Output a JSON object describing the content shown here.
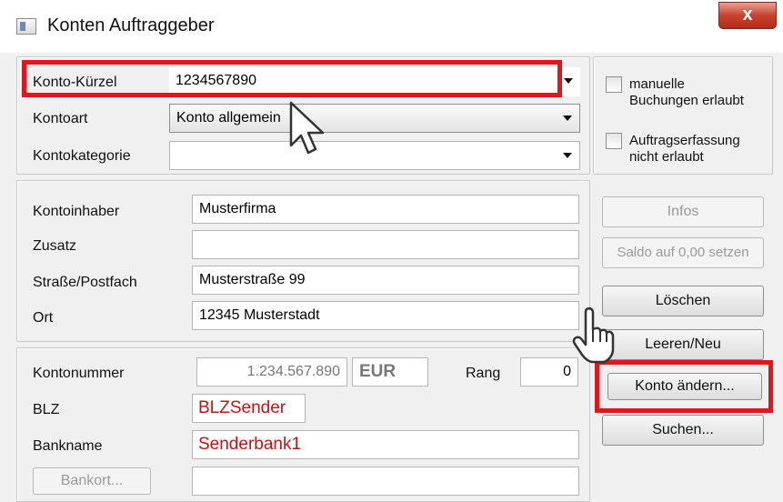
{
  "window": {
    "title": "Konten Auftraggeber",
    "close_symbol": "x"
  },
  "account": {
    "konto_kuerzel_label": "Konto-Kürzel",
    "konto_kuerzel_value": "1234567890",
    "kontoart_label": "Kontoart",
    "kontoart_value": "Konto allgemein",
    "kontokategorie_label": "Kontokategorie",
    "kontokategorie_value": ""
  },
  "options": {
    "manuelle_buchungen_line1": "manuelle",
    "manuelle_buchungen_line2": "Buchungen erlaubt",
    "auftragserfassung_line1": "Auftragserfassung",
    "auftragserfassung_line2": "nicht erlaubt"
  },
  "holder": {
    "kontoinhaber_label": "Kontoinhaber",
    "kontoinhaber_value": "Musterfirma",
    "zusatz_label": "Zusatz",
    "zusatz_value": "",
    "strasse_label": "Straße/Postfach",
    "strasse_value": "Musterstraße 99",
    "ort_label": "Ort",
    "ort_value": "12345 Musterstadt"
  },
  "bank": {
    "kontonummer_label": "Kontonummer",
    "kontonummer_value": "1.234.567.890",
    "currency": "EUR",
    "rang_label": "Rang",
    "rang_value": "0",
    "blz_label": "BLZ",
    "blz_value": "BLZSender",
    "bankname_label": "Bankname",
    "bankname_value": "Senderbank1",
    "bankort_button": "Bankort...",
    "bankort_value": ""
  },
  "buttons": {
    "infos": "Infos",
    "saldo": "Saldo auf 0,00 setzen",
    "loeschen": "Löschen",
    "leeren_neu": "Leeren/Neu",
    "konto_aendern": "Konto ändern...",
    "suchen": "Suchen..."
  },
  "colors": {
    "highlight": "#e2161a",
    "red_text": "#c01515"
  }
}
